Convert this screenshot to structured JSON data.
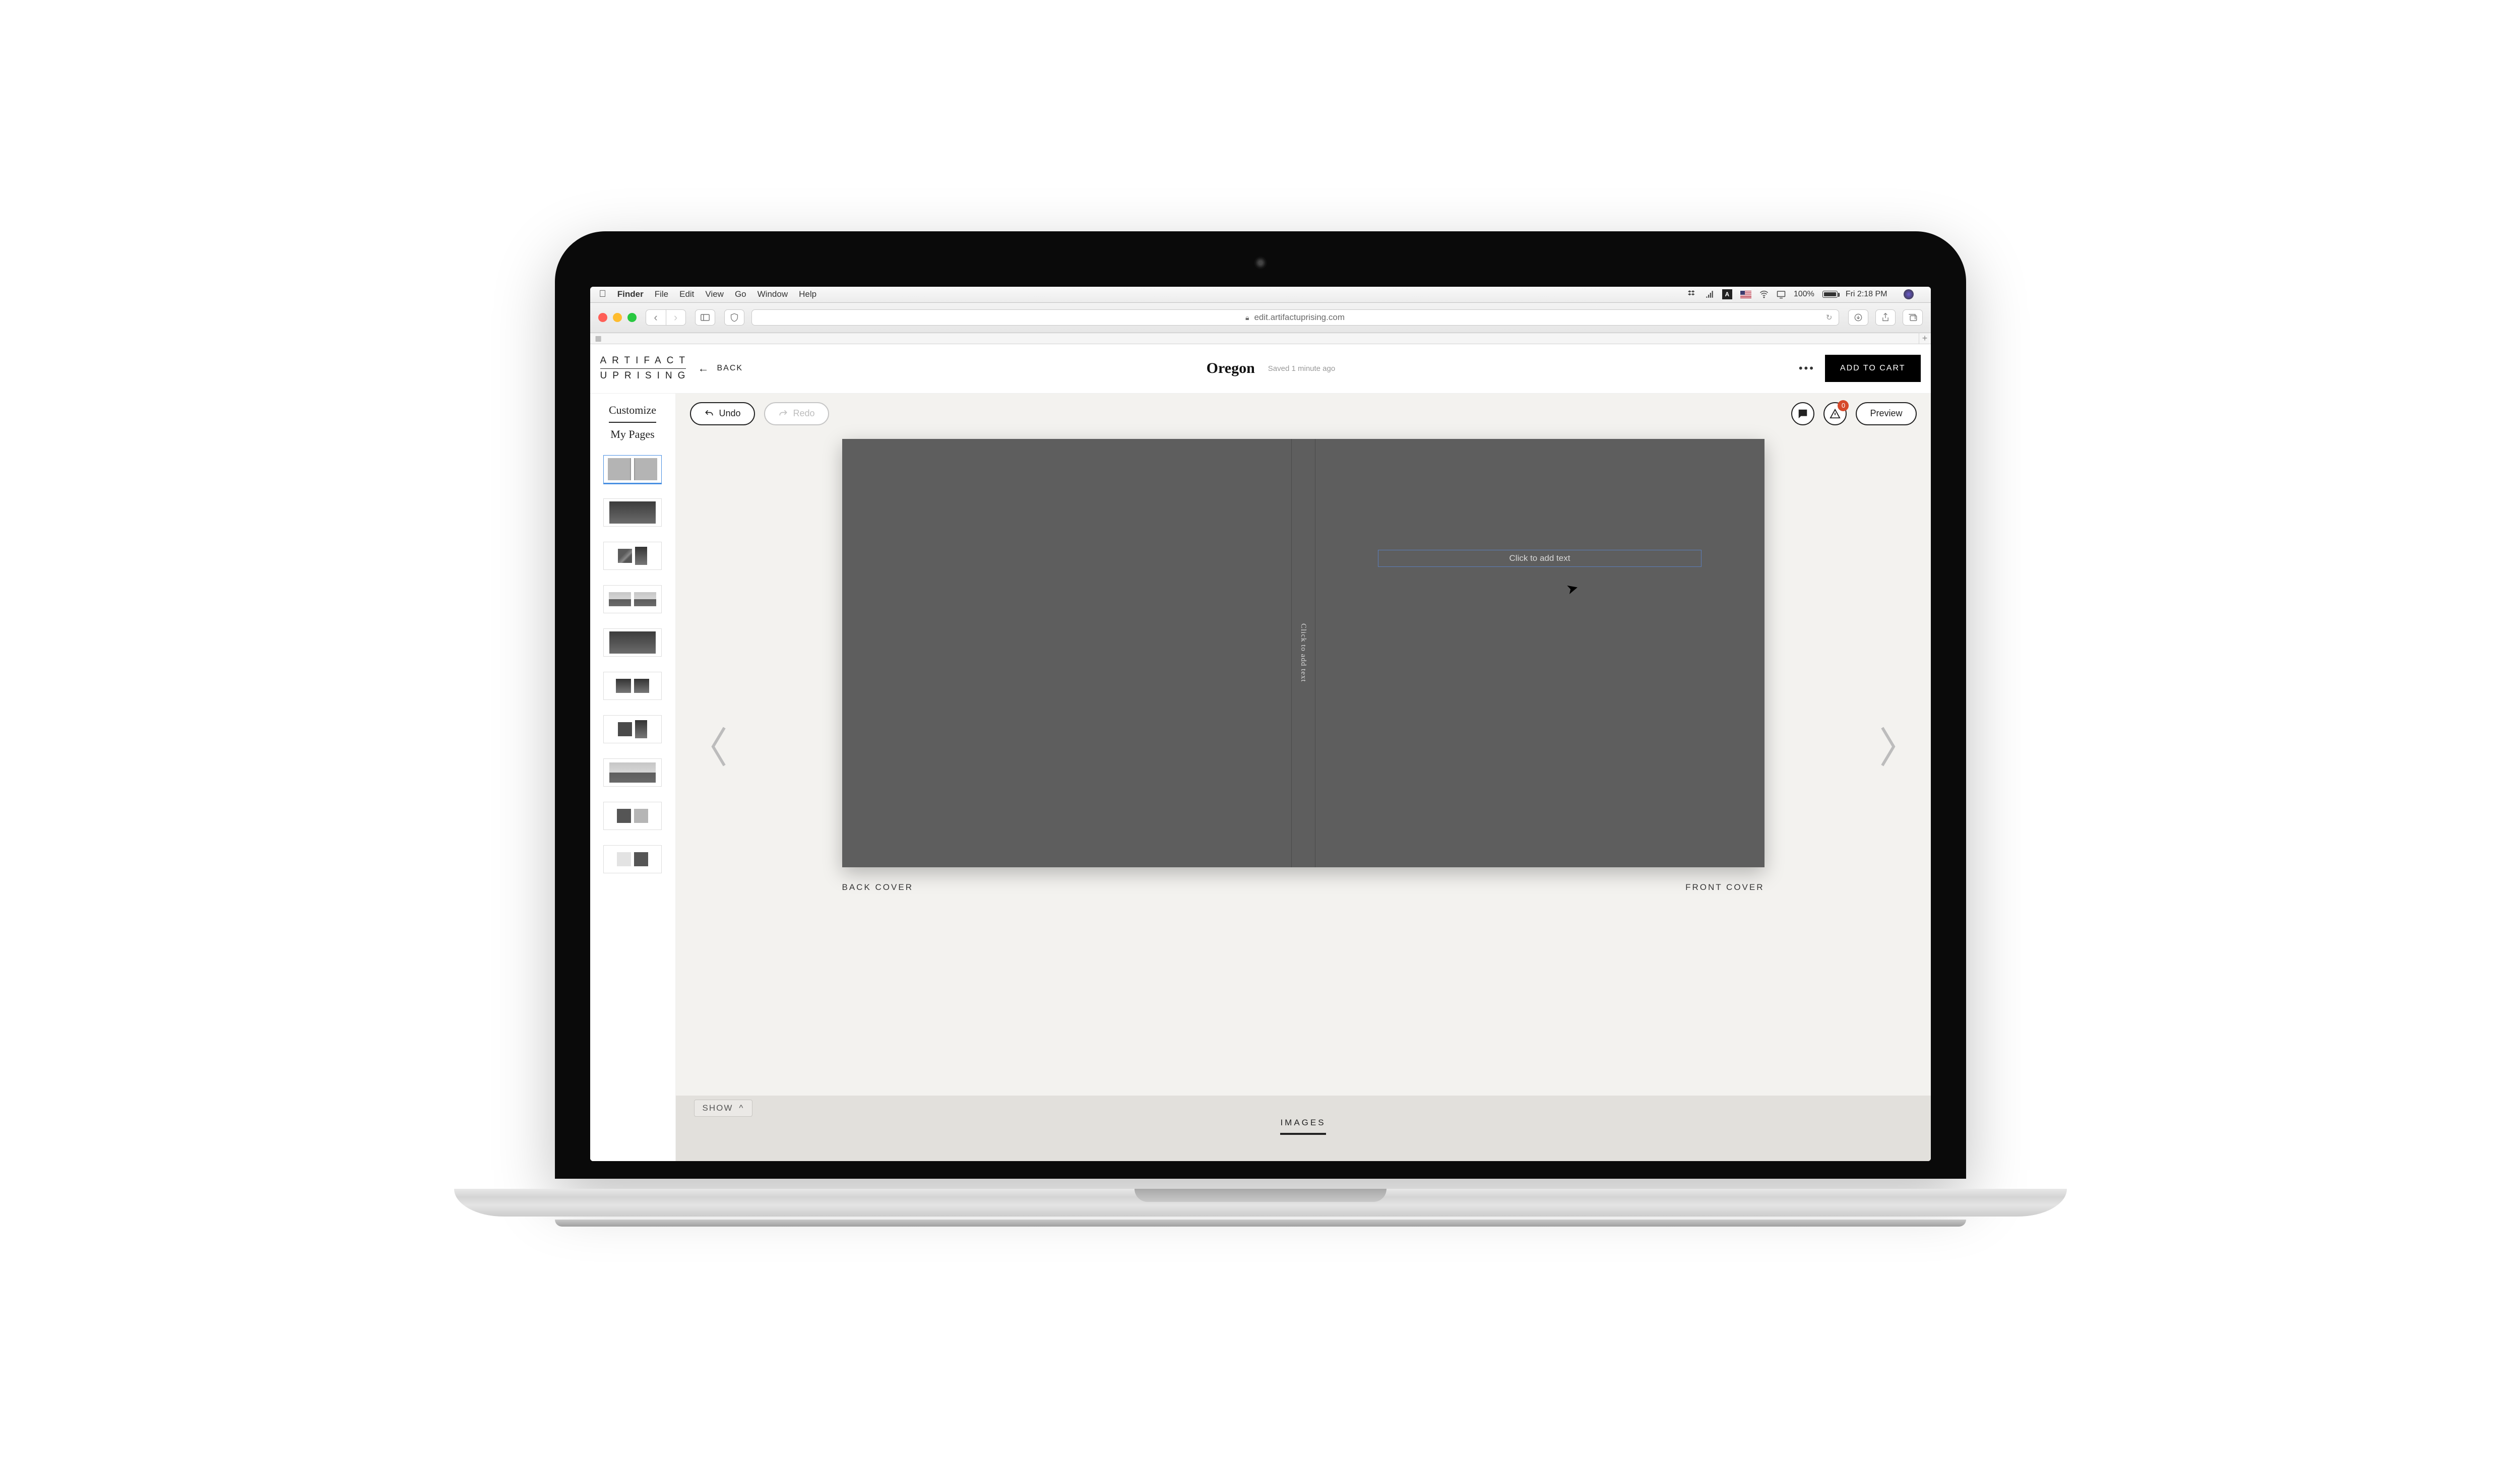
{
  "macos": {
    "finder": "Finder",
    "menus": [
      "File",
      "Edit",
      "View",
      "Go",
      "Window",
      "Help"
    ],
    "battery": "100%",
    "clock": "Fri 2:18 PM"
  },
  "safari": {
    "url": "edit.artifactuprising.com"
  },
  "brand": {
    "line1": "ARTIFACT",
    "line2": "UPRISING",
    "back": "BACK"
  },
  "project": {
    "title": "Oregon",
    "saved": "Saved 1 minute ago"
  },
  "header": {
    "add_to_cart": "ADD TO CART"
  },
  "side": {
    "customize": "Customize",
    "my_pages": "My Pages"
  },
  "toolbar": {
    "undo": "Undo",
    "redo": "Redo",
    "preview": "Preview",
    "warning_badge": "0"
  },
  "cover": {
    "title_placeholder": "Click to add text",
    "spine_placeholder": "Click to add text",
    "back_label": "BACK COVER",
    "front_label": "FRONT COVER"
  },
  "footer": {
    "show": "SHOW",
    "images": "IMAGES"
  }
}
